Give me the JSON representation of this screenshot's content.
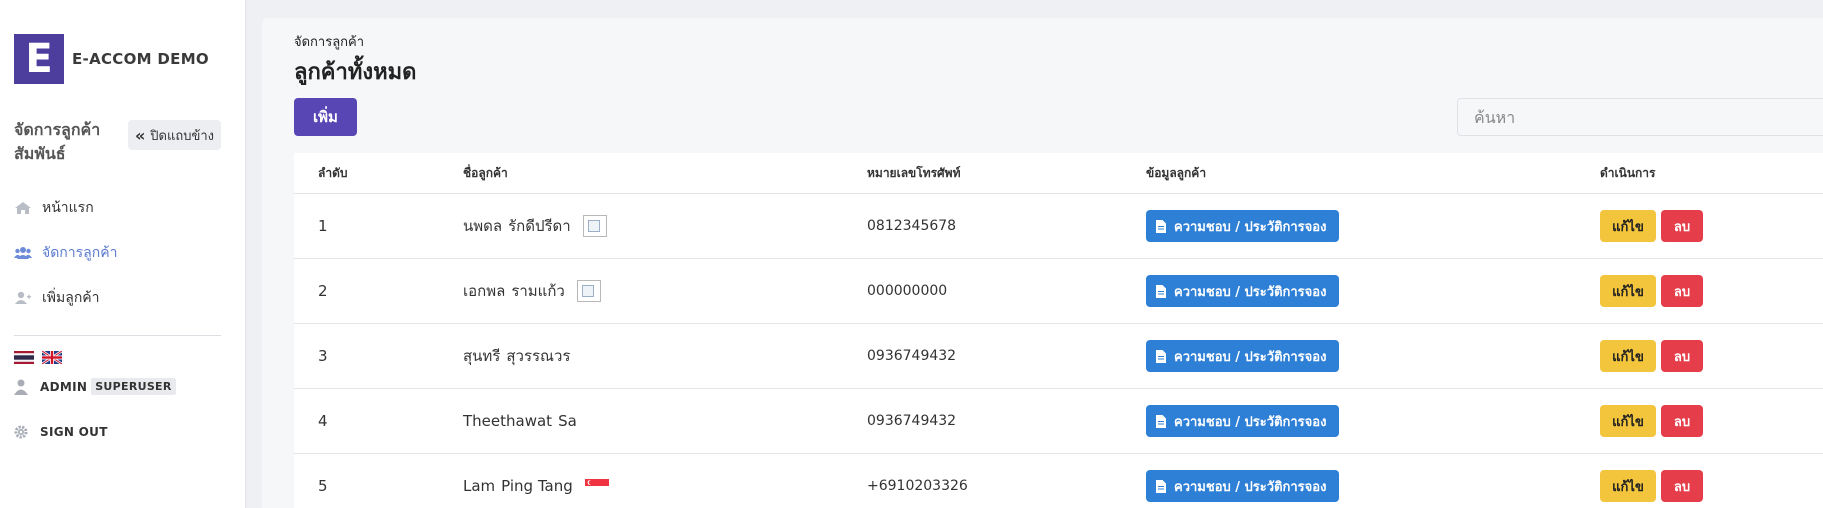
{
  "brand": {
    "logo_letter": "E",
    "name": "E-ACCOM DEMO"
  },
  "sidebar": {
    "section_title": "จัดการลูกค้าสัมพันธ์",
    "collapse_label": "ปิดแถบข้าง",
    "items": [
      {
        "label": "หน้าแรก",
        "icon": "home-icon"
      },
      {
        "label": "จัดการลูกค้า",
        "icon": "users-icon",
        "active": true
      },
      {
        "label": "เพิ่มลูกค้า",
        "icon": "user-plus-icon"
      }
    ],
    "languages": [
      "th-flag-icon",
      "uk-flag-icon"
    ],
    "user": {
      "name": "ADMIN",
      "badge": "SUPERUSER"
    },
    "signout_label": "SIGN OUT"
  },
  "main": {
    "breadcrumb": "จัดการลูกค้า",
    "title": "ลูกค้าทั้งหมด",
    "add_label": "เพิ่ม",
    "search_placeholder": "ค้นหา"
  },
  "table": {
    "headers": {
      "no": "ลำดับ",
      "name": "ชื่อลูกค้า",
      "phone": "หมายเลขโทรศัพท์",
      "info": "ข้อมูลลูกค้า",
      "actions": "ดำเนินการ"
    },
    "info_label": "ความชอบ / ประวัติการจอง",
    "edit_label": "แก้ไข",
    "delete_label": "ลบ",
    "rows": [
      {
        "no": "1",
        "first": "นพดล",
        "last": "รักดีปรีดา",
        "phone": "0812345678",
        "flag": "broken-image"
      },
      {
        "no": "2",
        "first": "เอกพล",
        "last": "รามแก้ว",
        "phone": "000000000",
        "flag": "broken-image"
      },
      {
        "no": "3",
        "first": "สุนทรี",
        "last": "สุวรรณวร",
        "phone": "0936749432",
        "flag": ""
      },
      {
        "no": "4",
        "first": "Theethawat",
        "last": "Sa",
        "phone": "0936749432",
        "flag": ""
      },
      {
        "no": "5",
        "first": "Lam",
        "last": "Ping Tang",
        "phone": "+6910203326",
        "flag": "singapore-flag"
      }
    ]
  },
  "colors": {
    "brand": "#4d3e9e",
    "add_button": "#5846b5",
    "info_button": "#2e7fd6",
    "edit_button": "#f2c53d",
    "delete_button": "#e53e4a",
    "active_nav": "#5a7bd0"
  }
}
